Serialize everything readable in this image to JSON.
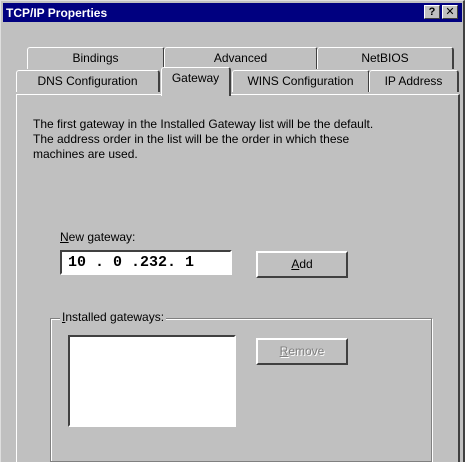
{
  "window": {
    "title": "TCP/IP Properties",
    "help_button": "?",
    "close_button": "✕"
  },
  "tabs": {
    "row1": [
      {
        "label": "Bindings"
      },
      {
        "label": "Advanced"
      },
      {
        "label": "NetBIOS"
      }
    ],
    "row2": [
      {
        "label": "DNS Configuration"
      },
      {
        "label": "Gateway",
        "active": true
      },
      {
        "label": "WINS Configuration"
      },
      {
        "label": "IP Address"
      }
    ]
  },
  "gateway": {
    "description_line1": "The first gateway in the Installed Gateway list will be the default.",
    "description_line2": "The address order in the list will be the order in which these",
    "description_line3": "machines are used.",
    "new_gateway_mnemonic": "N",
    "new_gateway_label_rest": "ew gateway:",
    "new_gateway_value": "10 . 0 .232. 1",
    "add_mnemonic": "A",
    "add_rest": "dd",
    "installed_mnemonic": "I",
    "installed_rest": "nstalled gateways:",
    "remove_mnemonic": "R",
    "remove_rest": "emove"
  }
}
